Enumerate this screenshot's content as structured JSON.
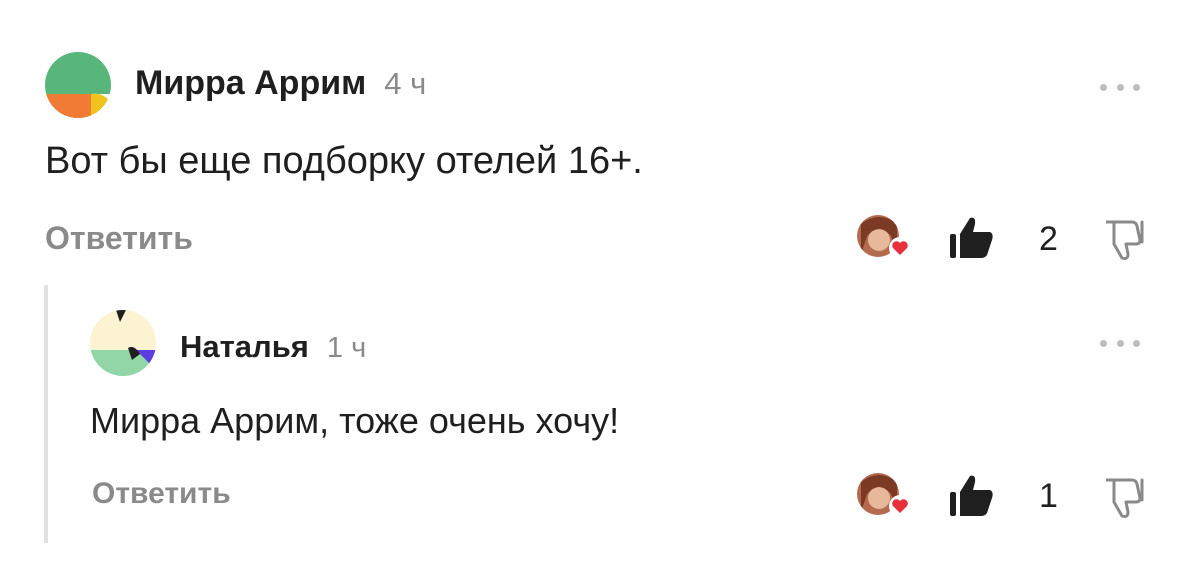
{
  "comments": [
    {
      "author": "Мирра Аррим",
      "time": "4 ч",
      "text": "Вот бы еще подборку отелей 16+.",
      "reply_label": "Ответить",
      "likes": "2"
    },
    {
      "author": "Наталья",
      "time": "1 ч",
      "text": "Мирра Аррим, тоже очень хочу!",
      "reply_label": "Ответить",
      "likes": "1"
    }
  ],
  "icons": {
    "more": "more-dots-icon",
    "like": "thumbs-up-icon",
    "dislike": "thumbs-down-icon",
    "reaction": "heart-reaction-icon"
  },
  "colors": {
    "text": "#1f1f1f",
    "muted": "#8a8a8a",
    "heart": "#e8303a",
    "thread_line": "#e2e2e2"
  }
}
